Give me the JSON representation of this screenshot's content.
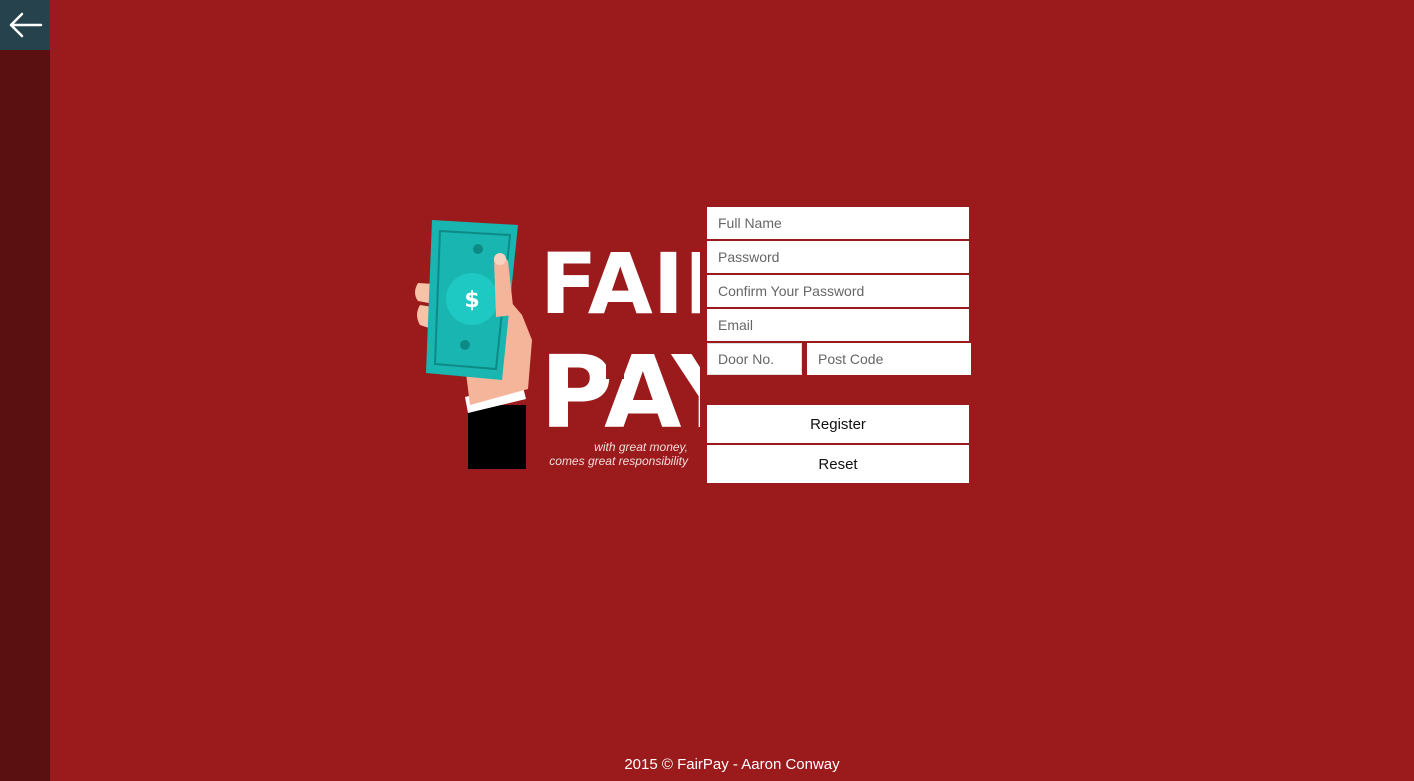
{
  "nav": {
    "back_icon": "arrow-left-icon"
  },
  "logo": {
    "line1": "FAIR",
    "line2": "PAY",
    "tagline1": "with great money,",
    "tagline2": "comes great responsibility",
    "money_icon": "dollar-bill-icon"
  },
  "form": {
    "full_name_placeholder": "Full Name",
    "password_placeholder": "Password",
    "confirm_password_placeholder": "Confirm Your Password",
    "email_placeholder": "Email",
    "door_placeholder": "Door No.",
    "postcode_placeholder": "Post Code",
    "register_label": "Register",
    "reset_label": "Reset"
  },
  "footer": {
    "text": "2015 © FairPay - Aaron Conway"
  },
  "colors": {
    "background": "#9b1b1c",
    "sidebar": "#5a0f10",
    "back_button": "#26424d",
    "bill": "#19b5b0"
  }
}
